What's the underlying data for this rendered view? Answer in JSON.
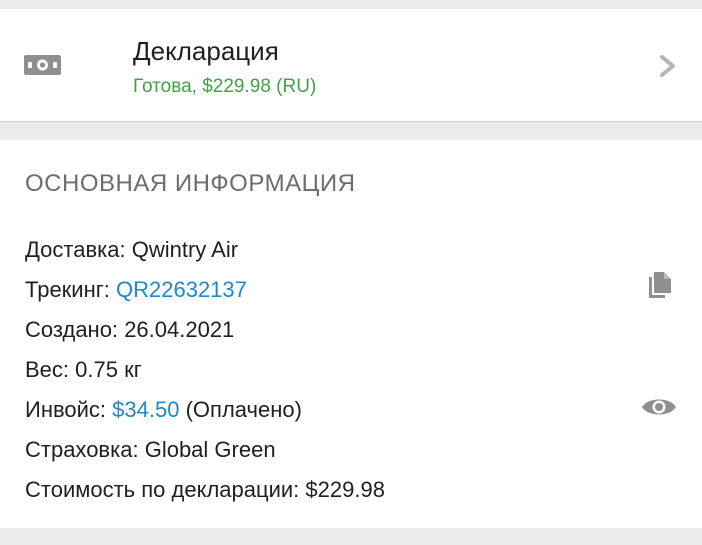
{
  "declaration": {
    "icon": "money-icon",
    "title": "Декларация",
    "status": "Готова, $229.98 (RU)",
    "status_color": "#43a047"
  },
  "info": {
    "section_title": "ОСНОВНАЯ ИНФОРМАЦИЯ",
    "delivery": {
      "label": "Доставка:",
      "value": "Qwintry Air"
    },
    "tracking": {
      "label": "Трекинг:",
      "value": "QR22632137"
    },
    "created": {
      "label": "Создано:",
      "value": "26.04.2021"
    },
    "weight": {
      "label": "Вес:",
      "value": "0.75 кг"
    },
    "invoice": {
      "label": "Инвойс:",
      "amount": "$34.50",
      "status": "(Оплачено)"
    },
    "insurance": {
      "label": "Страховка:",
      "value": "Global Green"
    },
    "declared_value": {
      "label": "Стоимость по декларации:",
      "value": "$229.98"
    }
  },
  "colors": {
    "link": "#1e88c8",
    "accent_green": "#43a047"
  }
}
